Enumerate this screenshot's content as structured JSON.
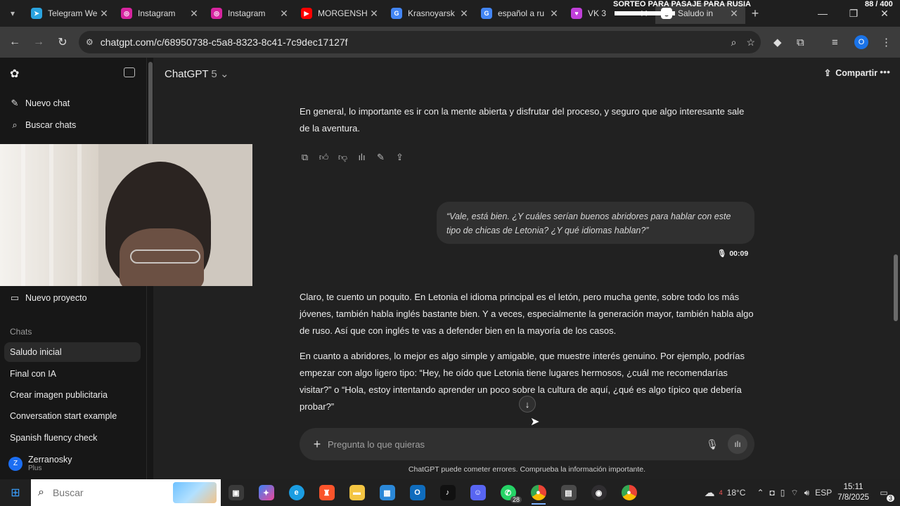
{
  "browser": {
    "tabs": [
      {
        "title": "Telegram We",
        "color": "#2aa3df",
        "glyph": "➤"
      },
      {
        "title": "Instagram",
        "color": "#d6249f",
        "glyph": "◎"
      },
      {
        "title": "Instagram",
        "color": "#d6249f",
        "glyph": "◎"
      },
      {
        "title": "MORGENSH",
        "color": "#ff0000",
        "glyph": "▶"
      },
      {
        "title": "Krasnoyarsk",
        "color": "#4285f4",
        "glyph": "G"
      },
      {
        "title": "español a ru",
        "color": "#4285f4",
        "glyph": "G"
      },
      {
        "title": "VK 3",
        "color": "#c03fd9",
        "glyph": "♥"
      },
      {
        "title": "Saludo in",
        "color": "#ffffff",
        "glyph": "◉"
      }
    ],
    "overlay_banner": "SORTEO PARA PASAJE PARA RUSIA",
    "overlay_count": "88 / 400",
    "url": "chatgpt.com/c/68950738-c5a8-8323-8c41-7c9dec17127f",
    "profile_initial": "O"
  },
  "sidebar": {
    "new_chat": "Nuevo chat",
    "search_chats": "Buscar chats",
    "new_project": "Nuevo proyecto",
    "chats_heading": "Chats",
    "chats": [
      "Saludo inicial",
      "Final con IA",
      "Crear imagen publicitaria",
      "Conversation start example",
      "Spanish fluency check"
    ],
    "user": {
      "initial": "Z",
      "name": "Zerranosky",
      "plan": "Plus"
    }
  },
  "header": {
    "model": "ChatGPT",
    "model_version": "5",
    "share": "Compartir"
  },
  "conversation": {
    "assistant_1": "En general, lo importante es ir con la mente abierta y disfrutar del proceso, y seguro que algo interesante sale de la aventura.",
    "user_voice": "“Vale, está bien. ¿Y cuáles serían buenos abridores para hablar con este tipo de chicas de Letonia? ¿Y qué idiomas hablan?”",
    "voice_duration": "00:09",
    "assistant_2a": "Claro, te cuento un poquito. En Letonia el idioma principal es el letón, pero mucha gente, sobre todo los más jóvenes, también habla inglés bastante bien. Y a veces, especialmente la generación mayor, también habla algo de ruso. Así que con inglés te vas a defender bien en la mayoría de los casos.",
    "assistant_2b": "En cuanto a abridores, lo mejor es algo simple y amigable, que muestre interés genuino. Por ejemplo, podrías empezar con algo ligero tipo: “Hey, he oído que Letonia tiene lugares hermosos, ¿cuál me recomendarías visitar?” o “Hola, estoy intentando aprender un poco sobre la cultura de aquí, ¿qué es algo típico que debería probar?”"
  },
  "composer": {
    "placeholder": "Pregunta lo que quieras",
    "disclaimer": "ChatGPT puede cometer errores. Comprueba la información importante."
  },
  "taskbar": {
    "search_placeholder": "Buscar",
    "whatsapp_badge": "28",
    "weather": "18°C",
    "weather_badge": "4",
    "language": "ESP",
    "time": "15:11",
    "date": "7/8/2025",
    "notifications": "3"
  }
}
